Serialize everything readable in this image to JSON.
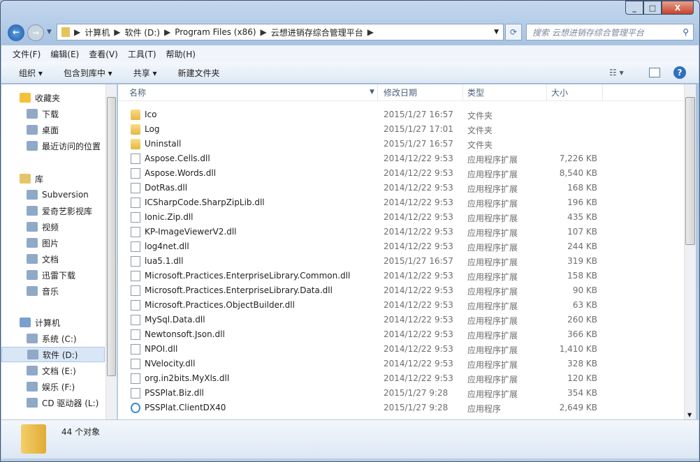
{
  "window": {
    "controls": [
      "minimize",
      "maximize",
      "close"
    ]
  },
  "address": {
    "crumbs": [
      "计算机",
      "软件 (D:)",
      "Program Files (x86)",
      "云想进销存综合管理平台"
    ]
  },
  "search": {
    "placeholder": "搜索 云想进销存综合管理平台"
  },
  "menu": [
    "文件(F)",
    "编辑(E)",
    "查看(V)",
    "工具(T)",
    "帮助(H)"
  ],
  "toolbar": {
    "organize": "组织 ▾",
    "include": "包含到库中 ▾",
    "share": "共享 ▾",
    "new_folder": "新建文件夹"
  },
  "nav": {
    "favorites": {
      "label": "收藏夹",
      "items": [
        "下载",
        "桌面",
        "最近访问的位置"
      ]
    },
    "libraries": {
      "label": "库",
      "items": [
        "Subversion",
        "爱奇艺影视库",
        "视频",
        "图片",
        "文档",
        "迅雷下载",
        "音乐"
      ]
    },
    "computer": {
      "label": "计算机",
      "items": [
        "系统 (C:)",
        "软件 (D:)",
        "文档 (E:)",
        "娱乐 (F:)",
        "CD 驱动器 (L:)"
      ]
    },
    "selected": "软件 (D:)"
  },
  "columns": {
    "name": "名称",
    "date": "修改日期",
    "type": "类型",
    "size": "大小"
  },
  "files": [
    {
      "name": "Ico",
      "date": "2015/1/27 16:57",
      "type": "文件夹",
      "size": "",
      "icon": "folder"
    },
    {
      "name": "Log",
      "date": "2015/1/27 17:01",
      "type": "文件夹",
      "size": "",
      "icon": "folder"
    },
    {
      "name": "Uninstall",
      "date": "2015/1/27 16:57",
      "type": "文件夹",
      "size": "",
      "icon": "folder"
    },
    {
      "name": "Aspose.Cells.dll",
      "date": "2014/12/22 9:53",
      "type": "应用程序扩展",
      "size": "7,226 KB",
      "icon": "dll"
    },
    {
      "name": "Aspose.Words.dll",
      "date": "2014/12/22 9:53",
      "type": "应用程序扩展",
      "size": "8,540 KB",
      "icon": "dll"
    },
    {
      "name": "DotRas.dll",
      "date": "2014/12/22 9:53",
      "type": "应用程序扩展",
      "size": "168 KB",
      "icon": "dll"
    },
    {
      "name": "ICSharpCode.SharpZipLib.dll",
      "date": "2014/12/22 9:53",
      "type": "应用程序扩展",
      "size": "196 KB",
      "icon": "dll"
    },
    {
      "name": "Ionic.Zip.dll",
      "date": "2014/12/22 9:53",
      "type": "应用程序扩展",
      "size": "435 KB",
      "icon": "dll"
    },
    {
      "name": "KP-ImageViewerV2.dll",
      "date": "2014/12/22 9:53",
      "type": "应用程序扩展",
      "size": "107 KB",
      "icon": "dll"
    },
    {
      "name": "log4net.dll",
      "date": "2014/12/22 9:53",
      "type": "应用程序扩展",
      "size": "244 KB",
      "icon": "dll"
    },
    {
      "name": "lua5.1.dll",
      "date": "2015/1/27 16:57",
      "type": "应用程序扩展",
      "size": "319 KB",
      "icon": "dll"
    },
    {
      "name": "Microsoft.Practices.EnterpriseLibrary.Common.dll",
      "date": "2014/12/22 9:53",
      "type": "应用程序扩展",
      "size": "158 KB",
      "icon": "dll"
    },
    {
      "name": "Microsoft.Practices.EnterpriseLibrary.Data.dll",
      "date": "2014/12/22 9:53",
      "type": "应用程序扩展",
      "size": "90 KB",
      "icon": "dll"
    },
    {
      "name": "Microsoft.Practices.ObjectBuilder.dll",
      "date": "2014/12/22 9:53",
      "type": "应用程序扩展",
      "size": "63 KB",
      "icon": "dll"
    },
    {
      "name": "MySql.Data.dll",
      "date": "2014/12/22 9:53",
      "type": "应用程序扩展",
      "size": "260 KB",
      "icon": "dll"
    },
    {
      "name": "Newtonsoft.Json.dll",
      "date": "2014/12/22 9:53",
      "type": "应用程序扩展",
      "size": "366 KB",
      "icon": "dll"
    },
    {
      "name": "NPOI.dll",
      "date": "2014/12/22 9:53",
      "type": "应用程序扩展",
      "size": "1,410 KB",
      "icon": "dll"
    },
    {
      "name": "NVelocity.dll",
      "date": "2014/12/22 9:53",
      "type": "应用程序扩展",
      "size": "328 KB",
      "icon": "dll"
    },
    {
      "name": "org.in2bits.MyXls.dll",
      "date": "2014/12/22 9:53",
      "type": "应用程序扩展",
      "size": "120 KB",
      "icon": "dll"
    },
    {
      "name": "PSSPlat.Biz.dll",
      "date": "2015/1/27 9:28",
      "type": "应用程序扩展",
      "size": "354 KB",
      "icon": "dll"
    },
    {
      "name": "PSSPlat.ClientDX40",
      "date": "2015/1/27 9:28",
      "type": "应用程序",
      "size": "2,649 KB",
      "icon": "exe"
    }
  ],
  "status": {
    "count": "44 个对象"
  }
}
